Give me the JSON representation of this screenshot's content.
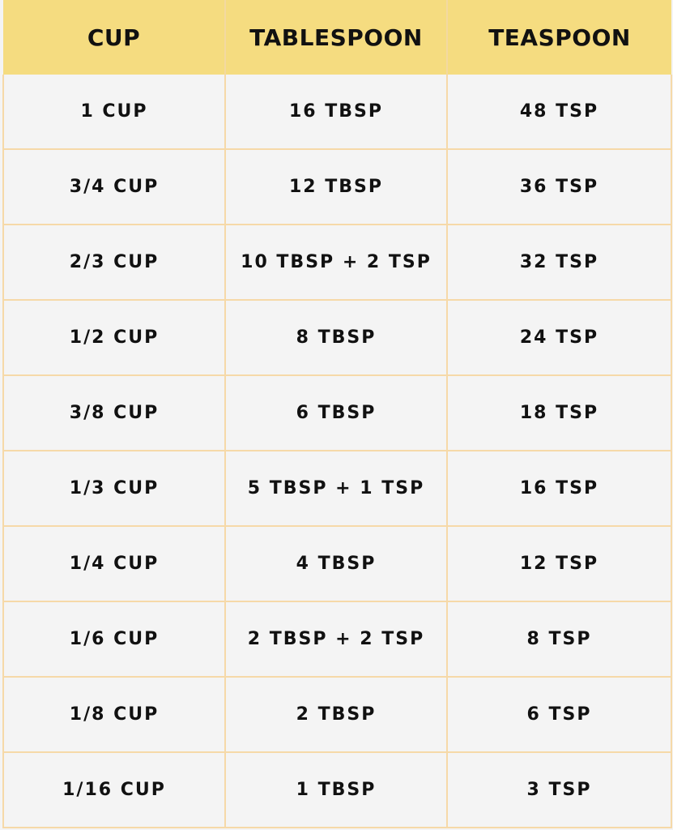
{
  "table": {
    "headers": [
      "CUP",
      "TABLESPOON",
      "TEASPOON"
    ],
    "rows": [
      [
        "1 CUP",
        "16 TBSP",
        "48 TSP"
      ],
      [
        "3/4 CUP",
        "12 TBSP",
        "36 TSP"
      ],
      [
        "2/3 CUP",
        "10 TBSP + 2 TSP",
        "32 TSP"
      ],
      [
        "1/2 CUP",
        "8 TBSP",
        "24 TSP"
      ],
      [
        "3/8 CUP",
        "6 TBSP",
        "18 TSP"
      ],
      [
        "1/3 CUP",
        "5 TBSP + 1 TSP",
        "16 TSP"
      ],
      [
        "1/4 CUP",
        "4 TBSP",
        "12 TSP"
      ],
      [
        "1/6 CUP",
        "2 TBSP + 2 TSP",
        "8 TSP"
      ],
      [
        "1/8 CUP",
        "2 TBSP",
        "6 TSP"
      ],
      [
        "1/16 CUP",
        "1 TBSP",
        "3 TSP"
      ]
    ]
  },
  "colors": {
    "header_bg": "#f5dc80",
    "cell_bg": "#f4f4f4",
    "grid_line": "#f6d9a8",
    "text": "#111111"
  }
}
